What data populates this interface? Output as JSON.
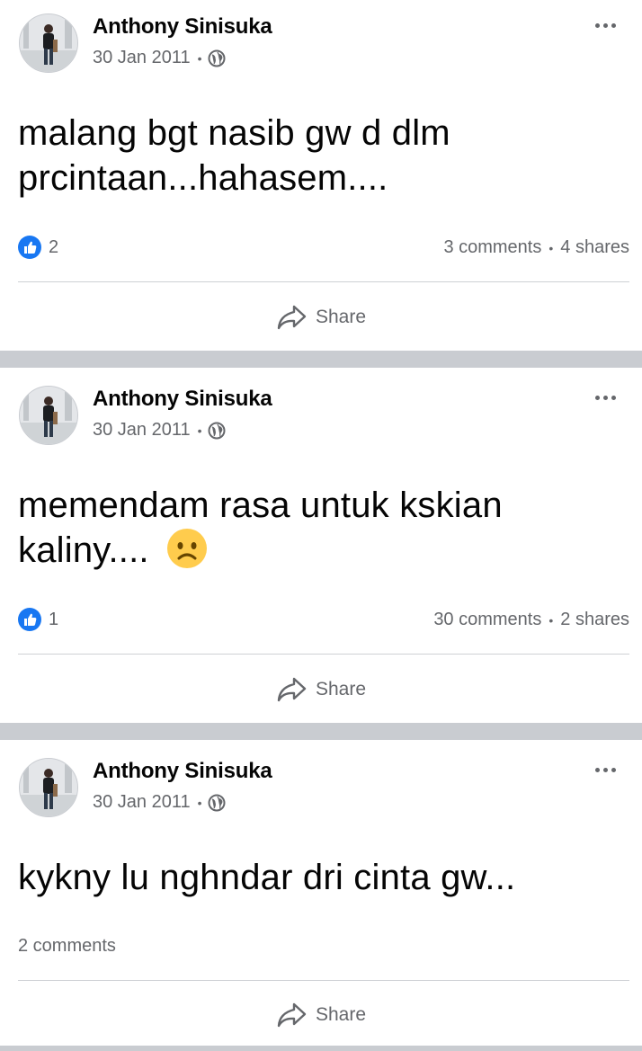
{
  "feed": {
    "posts": [
      {
        "author": "Anthony Sinisuka",
        "date": "30 Jan 2011",
        "separator": "•",
        "privacy_icon": "globe-icon",
        "text_lines": [
          "malang bgt nasib gw d dlm",
          "prcintaan...hahasem...."
        ],
        "likes": "2",
        "comments": "3 comments",
        "shares": "4 shares",
        "share_label": "Share"
      },
      {
        "author": "Anthony Sinisuka",
        "date": "30 Jan 2011",
        "separator": "•",
        "privacy_icon": "globe-icon",
        "text_lines": [
          "memendam rasa untuk kskian",
          "kaliny...."
        ],
        "emoji": "slightly-frowning-face",
        "likes": "1",
        "comments": "30 comments",
        "shares": "2 shares",
        "share_label": "Share"
      },
      {
        "author": "Anthony Sinisuka",
        "date": "30 Jan 2011",
        "separator": "•",
        "privacy_icon": "globe-icon",
        "text_lines": [
          "kykny lu nghndar dri cinta gw..."
        ],
        "comments": "2 comments",
        "share_label": "Share"
      }
    ]
  },
  "colors": {
    "like_blue": "#1877f2",
    "secondary_text": "#65676b",
    "separator_gray": "#c9ccd1",
    "emoji_yellow": "#ffcc4d"
  }
}
